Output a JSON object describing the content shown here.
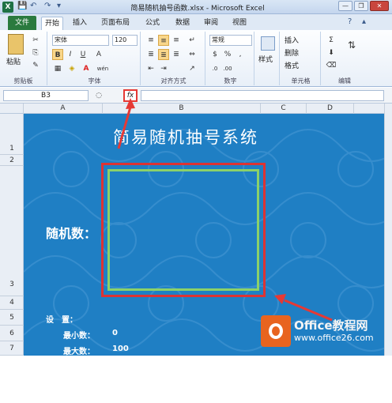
{
  "window": {
    "title": "简易随机抽号函数.xlsx - Microsoft Excel",
    "min": "—",
    "restore": "❐",
    "close": "✕"
  },
  "tabs": [
    "文件",
    "开始",
    "插入",
    "页面布局",
    "公式",
    "数据",
    "审阅",
    "视图"
  ],
  "ribbon": {
    "font_name": "宋体",
    "font_size": "120",
    "number_format": "常规",
    "paste": "粘贴",
    "style": "样式",
    "insert": "插入",
    "delete": "删除",
    "format": "格式",
    "groups": [
      "剪贴板",
      "字体",
      "对齐方式",
      "数字",
      "单元格",
      "编辑"
    ],
    "bold": "B",
    "italic": "I",
    "underline": "U",
    "font_color": "A",
    "grow": "A",
    "wen": "wén"
  },
  "formula_bar": {
    "name_box": "B3",
    "fx": "fx"
  },
  "columns": [
    "A",
    "B",
    "C",
    "D"
  ],
  "rows": [
    "1",
    "2",
    "3",
    "4",
    "5",
    "6",
    "7"
  ],
  "sheet": {
    "title": "简易随机抽号系统",
    "random_label": "随机数：",
    "settings_label": "设　置：",
    "min_label": "最小数：",
    "min_value": "0",
    "max_label": "最大数：",
    "max_value": "100"
  },
  "watermark": {
    "brand": "Office教程网",
    "url": "www.office26.com"
  },
  "colors": {
    "sheet_bg": "#1f7fc4",
    "highlight": "#e53935",
    "cell_border": "#8bd16a"
  }
}
